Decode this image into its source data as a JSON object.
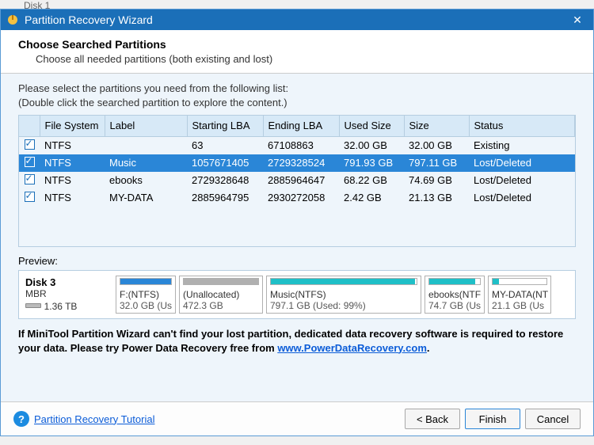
{
  "window": {
    "title": "Partition Recovery Wizard",
    "behind_label": "Disk 1"
  },
  "header": {
    "title": "Choose Searched Partitions",
    "subtitle": "Choose all needed partitions (both existing and lost)"
  },
  "instructions": {
    "line1": "Please select the partitions you need from the following list:",
    "line2": "(Double click the searched partition to explore the content.)"
  },
  "columns": {
    "fs": "File System",
    "label": "Label",
    "start": "Starting LBA",
    "end": "Ending LBA",
    "used": "Used Size",
    "size": "Size",
    "status": "Status"
  },
  "rows": [
    {
      "fs": "NTFS",
      "label": "",
      "start": "63",
      "end": "67108863",
      "used": "32.00 GB",
      "size": "32.00 GB",
      "status": "Existing"
    },
    {
      "fs": "NTFS",
      "label": "Music",
      "start": "1057671405",
      "end": "2729328524",
      "used": "791.93 GB",
      "size": "797.11 GB",
      "status": "Lost/Deleted"
    },
    {
      "fs": "NTFS",
      "label": "ebooks",
      "start": "2729328648",
      "end": "2885964647",
      "used": "68.22 GB",
      "size": "74.69 GB",
      "status": "Lost/Deleted"
    },
    {
      "fs": "NTFS",
      "label": "MY-DATA",
      "start": "2885964795",
      "end": "2930272058",
      "used": "2.42 GB",
      "size": "21.13 GB",
      "status": "Lost/Deleted"
    }
  ],
  "preview": {
    "label": "Preview:",
    "disk": {
      "name": "Disk 3",
      "type": "MBR",
      "capacity": "1.36 TB"
    },
    "parts": [
      {
        "name": "F:(NTFS)",
        "detail": "32.0 GB (Us",
        "bar_color": "#2a86d7",
        "fill": "100%",
        "w": "w-f"
      },
      {
        "name": "(Unallocated)",
        "detail": "472.3 GB",
        "bar_color": "#b0b0b0",
        "fill": "100%",
        "w": "w-un"
      },
      {
        "name": "Music(NTFS)",
        "detail": "797.1 GB (Used: 99%)",
        "bar_color": "#1fbfc7",
        "fill": "99%",
        "w": "w-mu"
      },
      {
        "name": "ebooks(NTF",
        "detail": "74.7 GB (Us",
        "bar_color": "#1fbfc7",
        "fill": "91%",
        "w": "w-eb"
      },
      {
        "name": "MY-DATA(NT",
        "detail": "21.1 GB (Us",
        "bar_color": "#1fbfc7",
        "fill": "12%",
        "w": "w-my"
      }
    ]
  },
  "notice": {
    "text1": "If MiniTool Partition Wizard can't find your lost partition, dedicated data recovery software is required to restore your data. Please try Power Data Recovery free from ",
    "link": "www.PowerDataRecovery.com",
    "period": "."
  },
  "footer": {
    "tutorial": "Partition Recovery Tutorial",
    "back": "< Back",
    "finish": "Finish",
    "cancel": "Cancel"
  }
}
